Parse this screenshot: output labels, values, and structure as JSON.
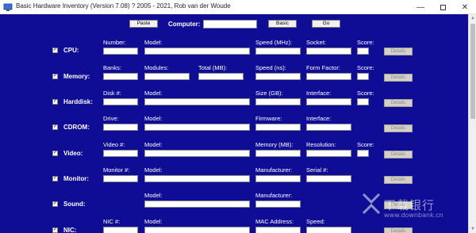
{
  "window": {
    "title": "Basic Hardware Inventory (Version 7.08) ? 2005 - 2021, Rob van der Woude"
  },
  "toolbar": {
    "paste_label": "Paste",
    "computer_label": "Computer:",
    "computer_value": "",
    "basic_label": "Basic",
    "go_label": "Go"
  },
  "details_label": "Details",
  "sections": [
    {
      "key": "cpu",
      "name": "CPU:",
      "labels": [
        "Number:",
        "Model:",
        "Speed (MHz):",
        "Socket:",
        "Score:"
      ]
    },
    {
      "key": "memory",
      "name": "Memory:",
      "labels": [
        "Banks:",
        "Modules:",
        "Total (MB):",
        "Speed (ns):",
        "Form Factor:",
        "Score:"
      ]
    },
    {
      "key": "harddisk",
      "name": "Harddisk:",
      "labels": [
        "Disk #:",
        "Model:",
        "Size (GB):",
        "Interface:",
        "Score:"
      ]
    },
    {
      "key": "cdrom",
      "name": "CDROM:",
      "labels": [
        "Drive:",
        "Model:",
        "Firmware:",
        "Interface:"
      ]
    },
    {
      "key": "video",
      "name": "Video:",
      "labels": [
        "Video #:",
        "Model:",
        "Memory (MB):",
        "Resolution:",
        "Score:"
      ]
    },
    {
      "key": "monitor",
      "name": "Monitor:",
      "labels": [
        "Monitor #:",
        "Model:",
        "Manufacturer:",
        "Serial #:"
      ]
    },
    {
      "key": "sound",
      "name": "Sound:",
      "labels": [
        "Model:",
        "Manufacturer:"
      ]
    },
    {
      "key": "nic",
      "name": "NIC:",
      "labels": [
        "NIC #:",
        "Model:",
        "MAC Address:",
        "Speed:"
      ]
    }
  ],
  "watermark": {
    "brand": "下载银行",
    "url": "www.downbank.cn"
  },
  "colors": {
    "background": "#0f0c96",
    "label": "#ffffff"
  }
}
